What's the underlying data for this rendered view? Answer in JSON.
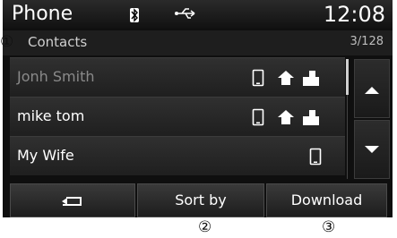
{
  "status_bar": {
    "app_title": "Phone",
    "clock": "12:08",
    "bluetooth_icon": "bluetooth-icon",
    "usb_icon": "usb-icon"
  },
  "header": {
    "label": "Contacts",
    "count": "3/128"
  },
  "contacts": [
    {
      "name": "Jonh Smith",
      "icons": [
        "mobile-phone-icon",
        "home-icon",
        "office-icon"
      ],
      "dimmed": true
    },
    {
      "name": "mike tom",
      "icons": [
        "mobile-phone-icon",
        "home-icon",
        "office-icon"
      ],
      "dimmed": false
    },
    {
      "name": "My Wife",
      "icons": [
        "mobile-phone-icon"
      ],
      "dimmed": false
    }
  ],
  "buttons": {
    "back_icon": "back-arrow-icon",
    "sort_label": "Sort by",
    "download_label": "Download"
  },
  "callouts": {
    "one": "①",
    "two": "②",
    "three": "③"
  },
  "colors": {
    "screen_bg": "#0f0f0f",
    "text": "#ffffff",
    "dim_text": "#8a8a8a"
  }
}
